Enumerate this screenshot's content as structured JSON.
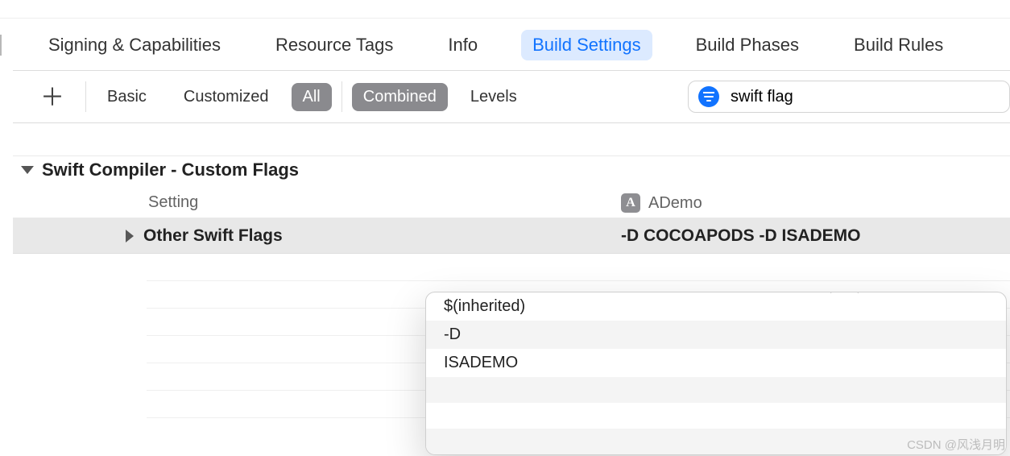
{
  "tabs": {
    "a": "Signing & Capabilities",
    "b": "Resource Tags",
    "c": "Info",
    "d": "Build Settings",
    "e": "Build Phases",
    "f": "Build Rules"
  },
  "toolbar": {
    "basic": "Basic",
    "customized": "Customized",
    "all": "All",
    "combined": "Combined",
    "levels": "Levels"
  },
  "search": {
    "value": "swift flag"
  },
  "section": {
    "title": "Swift Compiler - Custom Flags"
  },
  "columns": {
    "setting": "Setting",
    "target": "ADemo",
    "target_icon_letter": "A"
  },
  "row": {
    "name": "Other Swift Flags",
    "value": "-D COCOAPODS -D ISADEMO"
  },
  "popup": {
    "l1": "$(inherited)",
    "l2": "-D",
    "l3": "ISADEMO"
  },
  "watermark": "CSDN @风浅月明"
}
